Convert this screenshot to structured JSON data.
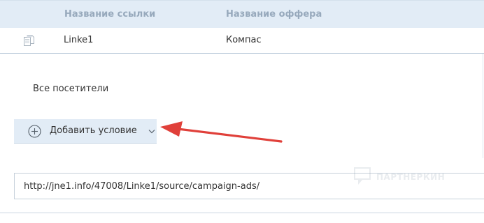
{
  "table": {
    "columns": [
      "Название ссылки",
      "Название оффера"
    ],
    "rows": [
      {
        "link_name": "Linke1",
        "offer_name": "Компас"
      }
    ]
  },
  "audience": {
    "label": "Все посетители"
  },
  "conditions": {
    "add_label": "Добавить условие"
  },
  "tracking_url": {
    "value": "http://jne1.info/47008/Linke1/source/campaign-ads/"
  },
  "watermark": {
    "text": "ПАРТНЕРКИН"
  },
  "colors": {
    "header_bg": "#e2ecf6",
    "header_text": "#97a9bc",
    "arrow": "#e0403a"
  },
  "icons": {
    "copy": "copy-icon",
    "add": "plus-circle-icon",
    "dropdown": "chevron-down-icon",
    "annotation": "red-arrow-icon"
  }
}
